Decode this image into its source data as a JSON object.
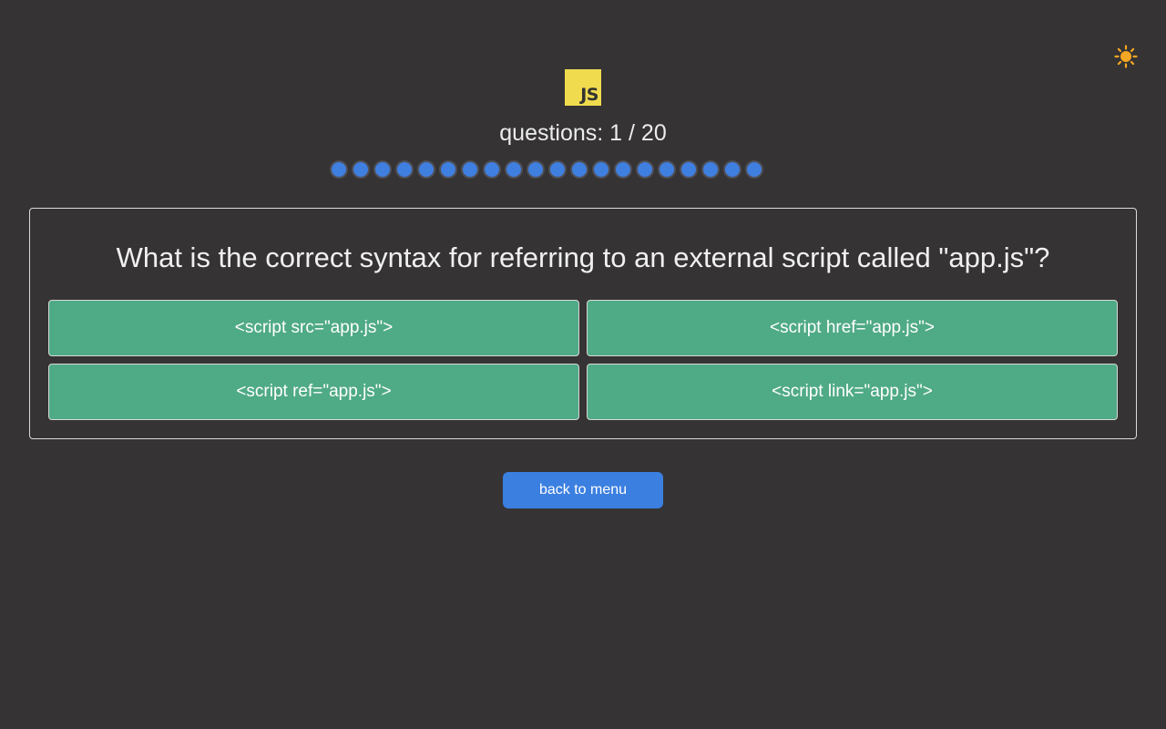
{
  "header": {
    "theme_toggle_icon": "sun-icon",
    "logo_text": "JS",
    "logo_color": "#f0db4f"
  },
  "progress": {
    "label": "questions: 1 / 20",
    "current": 1,
    "total": 20,
    "dot_color": "#3f7fe0"
  },
  "question": {
    "text": "What is the correct syntax for referring to an external script called \"app.js\"?",
    "answers": [
      "<script src=\"app.js\">",
      "<script href=\"app.js\">",
      "<script ref=\"app.js\">",
      "<script link=\"app.js\">"
    ],
    "answer_color": "#4faa86"
  },
  "footer": {
    "back_label": "back to menu",
    "back_color": "#3b7fe0"
  },
  "colors": {
    "background": "#353334",
    "sun": "#f5a623"
  }
}
